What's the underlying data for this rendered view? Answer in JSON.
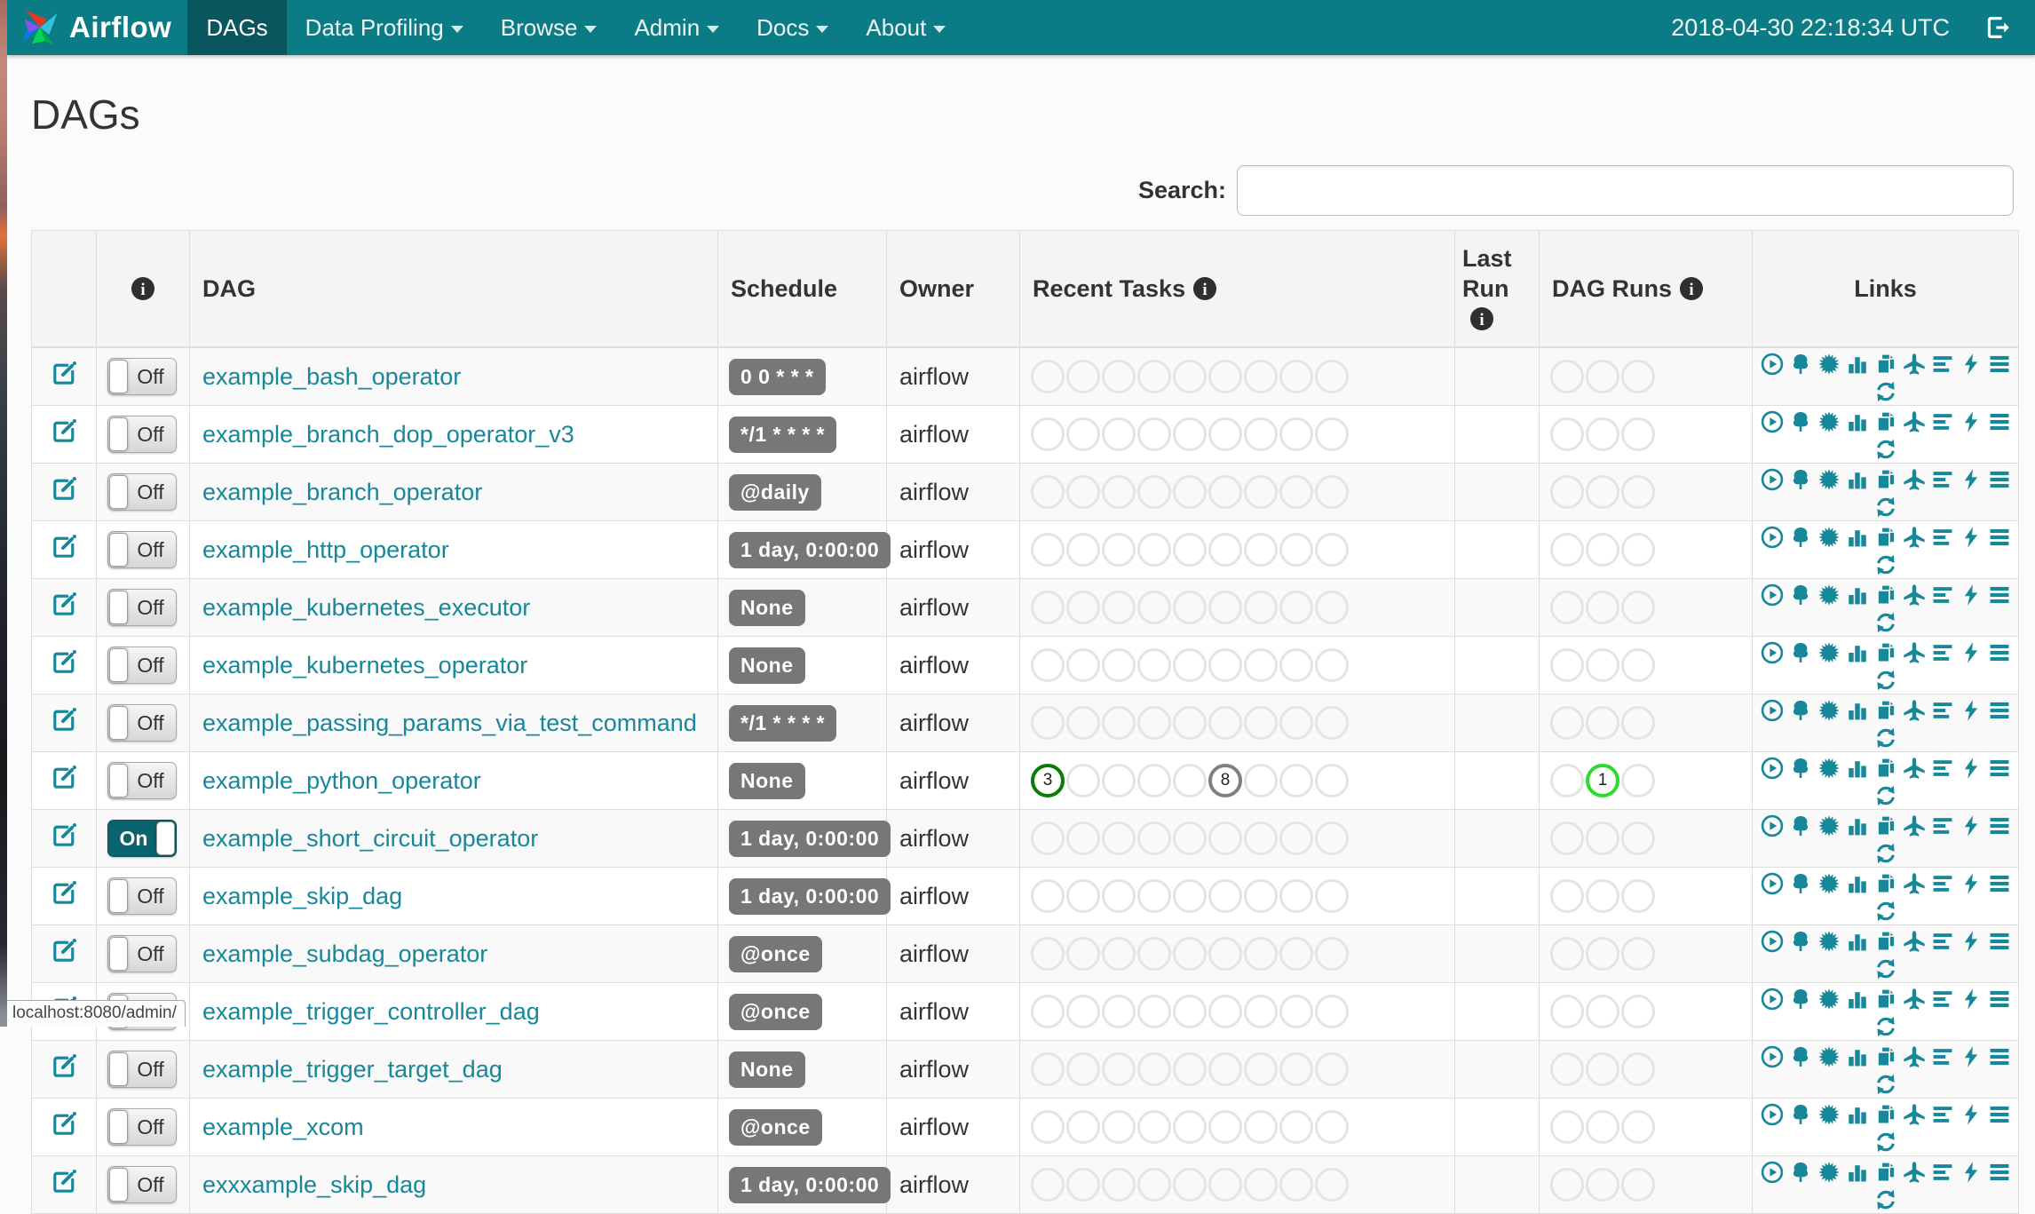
{
  "navbar": {
    "brand": "Airflow",
    "items": [
      {
        "label": "DAGs",
        "active": true,
        "caret": false
      },
      {
        "label": "Data Profiling",
        "active": false,
        "caret": true
      },
      {
        "label": "Browse",
        "active": false,
        "caret": true
      },
      {
        "label": "Admin",
        "active": false,
        "caret": true
      },
      {
        "label": "Docs",
        "active": false,
        "caret": true
      },
      {
        "label": "About",
        "active": false,
        "caret": true
      }
    ],
    "clock": "2018-04-30 22:18:34 UTC",
    "logout_icon": "sign-out-icon"
  },
  "page": {
    "title": "DAGs",
    "search_label": "Search:",
    "search_value": "",
    "status_bar_text": "localhost:8080/admin/"
  },
  "toggle": {
    "on_label": "On",
    "off_label": "Off"
  },
  "table": {
    "headers": {
      "edit": "",
      "info": "",
      "dag": "DAG",
      "schedule": "Schedule",
      "owner": "Owner",
      "recent_tasks": "Recent Tasks",
      "last_run": "Last Run",
      "dag_runs": "DAG Runs",
      "links": "Links"
    },
    "recent_task_slots": 9,
    "dag_run_slots": 3,
    "rows": [
      {
        "name": "example_bash_operator",
        "enabled": false,
        "schedule": "0 0 * * *",
        "owner": "airflow",
        "last_run": "",
        "recent_tasks": [],
        "dag_runs": []
      },
      {
        "name": "example_branch_dop_operator_v3",
        "enabled": false,
        "schedule": "*/1 * * * *",
        "owner": "airflow",
        "last_run": "",
        "recent_tasks": [],
        "dag_runs": []
      },
      {
        "name": "example_branch_operator",
        "enabled": false,
        "schedule": "@daily",
        "owner": "airflow",
        "last_run": "",
        "recent_tasks": [],
        "dag_runs": []
      },
      {
        "name": "example_http_operator",
        "enabled": false,
        "schedule": "1 day, 0:00:00",
        "owner": "airflow",
        "last_run": "",
        "recent_tasks": [],
        "dag_runs": []
      },
      {
        "name": "example_kubernetes_executor",
        "enabled": false,
        "schedule": "None",
        "owner": "airflow",
        "last_run": "",
        "recent_tasks": [],
        "dag_runs": []
      },
      {
        "name": "example_kubernetes_operator",
        "enabled": false,
        "schedule": "None",
        "owner": "airflow",
        "last_run": "",
        "recent_tasks": [],
        "dag_runs": []
      },
      {
        "name": "example_passing_params_via_test_command",
        "enabled": false,
        "schedule": "*/1 * * * *",
        "owner": "airflow",
        "last_run": "",
        "recent_tasks": [],
        "dag_runs": []
      },
      {
        "name": "example_python_operator",
        "enabled": false,
        "schedule": "None",
        "owner": "airflow",
        "last_run": "",
        "recent_tasks": [
          {
            "slot": 0,
            "count": "3",
            "color": "#077c07"
          },
          {
            "slot": 5,
            "count": "8",
            "color": "#808080"
          }
        ],
        "dag_runs": [
          {
            "slot": 1,
            "count": "1",
            "color": "#2bdd2b"
          }
        ]
      },
      {
        "name": "example_short_circuit_operator",
        "enabled": true,
        "schedule": "1 day, 0:00:00",
        "owner": "airflow",
        "last_run": "",
        "recent_tasks": [],
        "dag_runs": []
      },
      {
        "name": "example_skip_dag",
        "enabled": false,
        "schedule": "1 day, 0:00:00",
        "owner": "airflow",
        "last_run": "",
        "recent_tasks": [],
        "dag_runs": []
      },
      {
        "name": "example_subdag_operator",
        "enabled": false,
        "schedule": "@once",
        "owner": "airflow",
        "last_run": "",
        "recent_tasks": [],
        "dag_runs": []
      },
      {
        "name": "example_trigger_controller_dag",
        "enabled": false,
        "schedule": "@once",
        "owner": "airflow",
        "last_run": "",
        "recent_tasks": [],
        "dag_runs": []
      },
      {
        "name": "example_trigger_target_dag",
        "enabled": false,
        "schedule": "None",
        "owner": "airflow",
        "last_run": "",
        "recent_tasks": [],
        "dag_runs": []
      },
      {
        "name": "example_xcom",
        "enabled": false,
        "schedule": "@once",
        "owner": "airflow",
        "last_run": "",
        "recent_tasks": [],
        "dag_runs": []
      },
      {
        "name": "exxxample_skip_dag",
        "enabled": false,
        "schedule": "1 day, 0:00:00",
        "owner": "airflow",
        "last_run": "",
        "recent_tasks": [],
        "dag_runs": []
      }
    ]
  },
  "links": {
    "items": [
      {
        "name": "trigger-dag",
        "icon": "play-circle"
      },
      {
        "name": "tree-view",
        "icon": "tree"
      },
      {
        "name": "graph-view",
        "icon": "certificate"
      },
      {
        "name": "task-duration",
        "icon": "bar-chart"
      },
      {
        "name": "task-tries",
        "icon": "copy"
      },
      {
        "name": "landing-times",
        "icon": "plane"
      },
      {
        "name": "gantt",
        "icon": "align-left"
      },
      {
        "name": "code-view",
        "icon": "bolt"
      },
      {
        "name": "logs",
        "icon": "align-justify"
      },
      {
        "name": "refresh",
        "icon": "refresh"
      }
    ]
  },
  "colors": {
    "navbar_teal": "#0b7c85",
    "navbar_active": "#09565e",
    "toggle_on": "#0a636e",
    "link_teal": "#17879a",
    "badge_gray": "#777777",
    "circle_empty_border": "#e4e4e4",
    "task_success": "#077c07",
    "task_none": "#808080",
    "run_running": "#2bdd2b"
  }
}
